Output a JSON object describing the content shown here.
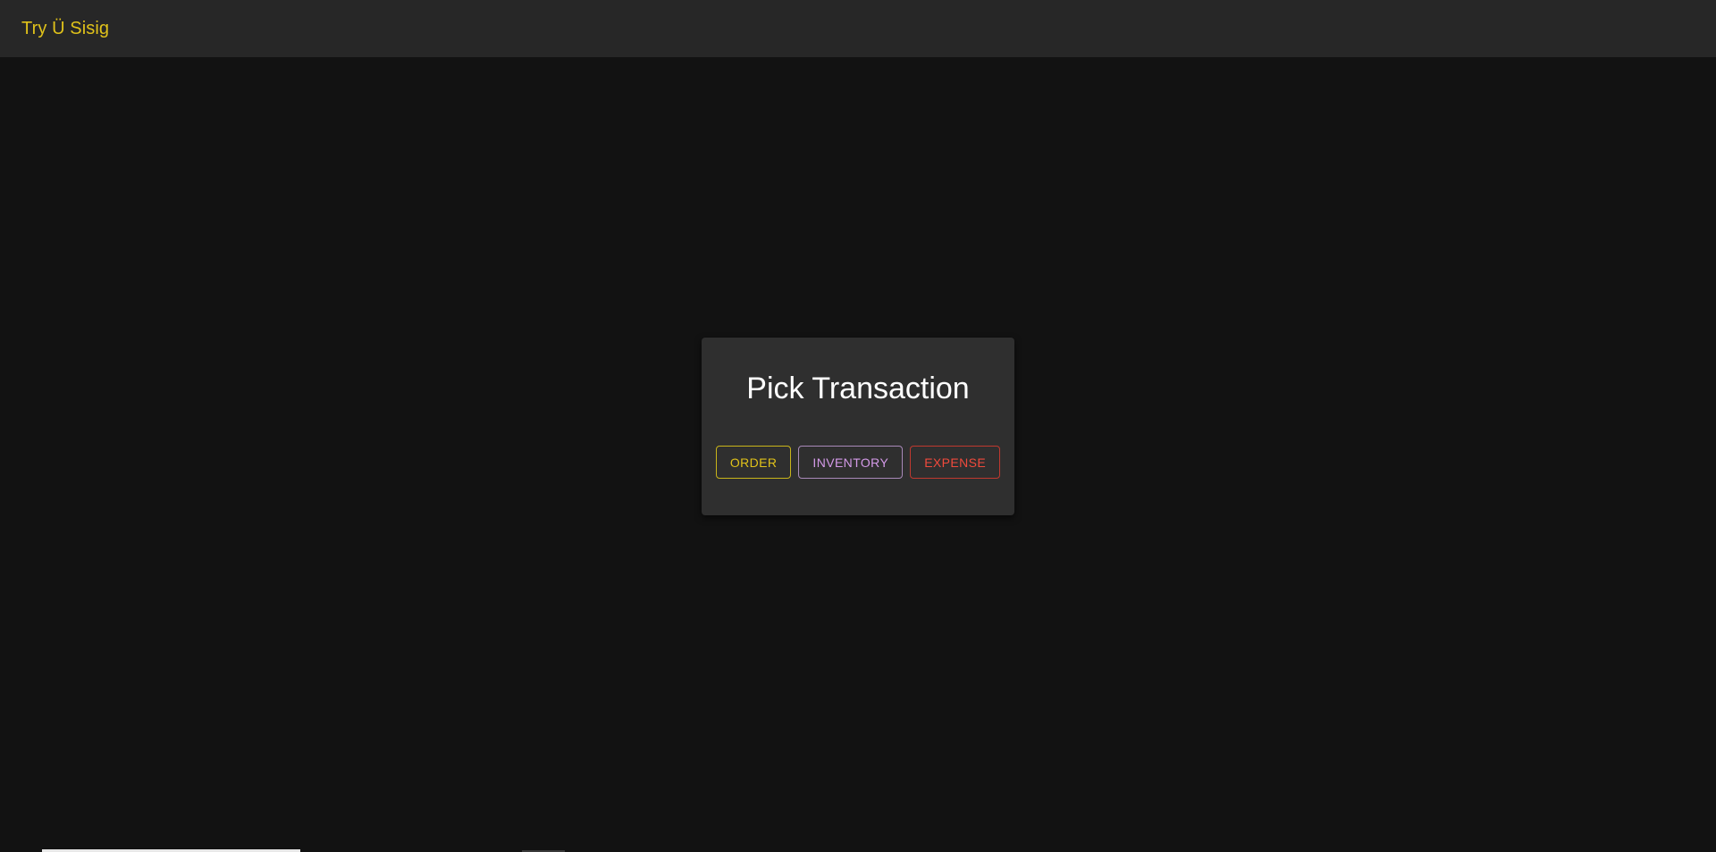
{
  "appbar": {
    "brand": "Try Ü Sisig"
  },
  "dialog": {
    "title": "Pick Transaction",
    "buttons": {
      "order": "ORDER",
      "inventory": "INVENTORY",
      "expense": "EXPENSE"
    }
  },
  "colors": {
    "background": "#121212",
    "appbar": "#272727",
    "card": "#2f2f2f",
    "brand": "#e0c21a",
    "order": "#e0c21a",
    "inventory": "#d49ae8",
    "expense": "#f04a3c"
  }
}
